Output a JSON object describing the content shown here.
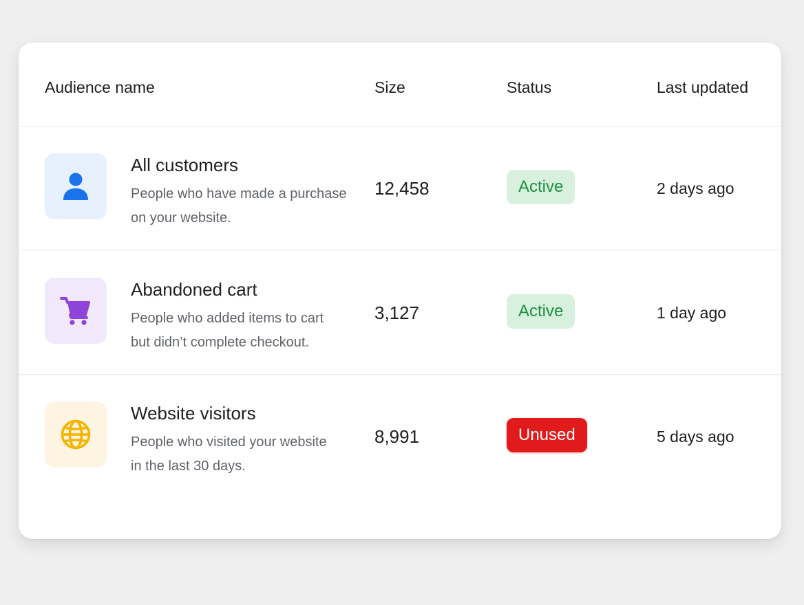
{
  "table": {
    "headers": {
      "audience_name": "Audience name",
      "size": "Size",
      "status": "Status",
      "last_updated": "Last updated"
    },
    "rows": [
      {
        "icon": "person-icon",
        "icon_color": "#1a73e8",
        "icon_bg": "#e7f0fd",
        "name": "All customers",
        "desc_line1": "People who have made a purchase",
        "desc_line2": "on your website.",
        "size": "12,458",
        "status": "Active",
        "last_updated": "2 days ago"
      },
      {
        "icon": "cart-icon",
        "icon_color": "#8e44d8",
        "icon_bg": "#f1e8fb",
        "name": "Abandoned cart",
        "desc_line1": "People who added items to cart",
        "desc_line2": "but didn’t complete checkout.",
        "size": "3,127",
        "status": "Active",
        "last_updated": "1 day ago"
      },
      {
        "icon": "globe-icon",
        "icon_color": "#f4b400",
        "icon_bg": "#fef4e2",
        "name": "Website visitors",
        "desc_line1": "People who visited your website",
        "desc_line2": "in the last 30 days.",
        "size": "8,991",
        "status": "Unused",
        "last_updated": "5 days ago"
      }
    ]
  },
  "colors": {
    "active_bg": "#d7f1de",
    "active_text": "#1e8e3e",
    "unused_bg": "#e11b1b",
    "unused_text": "#ffffff"
  }
}
